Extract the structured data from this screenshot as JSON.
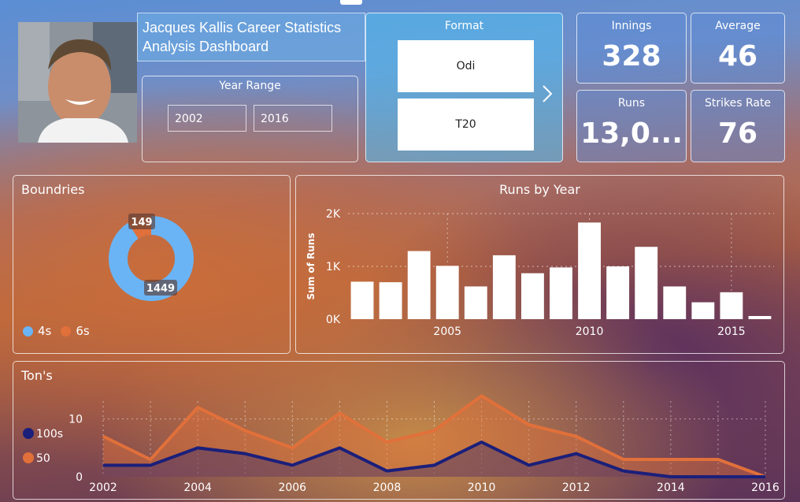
{
  "header": {
    "title": "Jacques Kallis Career Statistics Analysis Dashboard"
  },
  "year_range": {
    "title": "Year Range",
    "from": "2002",
    "to": "2016"
  },
  "format": {
    "title": "Format",
    "options": [
      "Odi",
      "T20"
    ],
    "next_icon": "chevron-right-icon"
  },
  "kpis": {
    "innings": {
      "label": "Innings",
      "value": "328"
    },
    "average": {
      "label": "Average",
      "value": "46"
    },
    "runs": {
      "label": "Runs",
      "value": "13,0..."
    },
    "strike_rate": {
      "label": "Strikes Rate",
      "value": "76"
    }
  },
  "colors": {
    "s4": "#6ab4f5",
    "s6": "#e1703a",
    "c100": "#1b1f7a",
    "c50": "#e1703a"
  },
  "boundaries": {
    "title": "Boundries",
    "legend": [
      "4s",
      "6s"
    ],
    "chart_data": {
      "type": "pie",
      "categories": [
        "4s",
        "6s"
      ],
      "values": [
        1449,
        149
      ],
      "labels": [
        "1449",
        "149"
      ]
    }
  },
  "runs_by_year": {
    "title": "Runs by Year",
    "ylabel": "Sum of Runs",
    "chart_data": {
      "type": "bar",
      "categories": [
        2002,
        2003,
        2004,
        2005,
        2006,
        2007,
        2008,
        2009,
        2010,
        2011,
        2012,
        2013,
        2014,
        2015,
        2016
      ],
      "values": [
        710,
        700,
        1290,
        1010,
        620,
        1210,
        870,
        980,
        1830,
        1000,
        1370,
        620,
        320,
        510,
        60
      ],
      "ylim": [
        0,
        2000
      ],
      "yticks": [
        "0K",
        "1K",
        "2K"
      ],
      "xticks": [
        "2005",
        "2010",
        "2015"
      ]
    }
  },
  "tons": {
    "title": "Ton's",
    "legend": [
      "100s",
      "50"
    ],
    "chart_data": {
      "type": "area",
      "x": [
        2002,
        2003,
        2004,
        2005,
        2006,
        2007,
        2008,
        2009,
        2010,
        2011,
        2012,
        2013,
        2014,
        2015,
        2016
      ],
      "series": [
        {
          "name": "100s",
          "values": [
            2,
            2,
            5,
            4,
            2,
            5,
            1,
            2,
            6,
            2,
            4,
            1,
            0,
            0,
            0
          ]
        },
        {
          "name": "50",
          "values": [
            7,
            3,
            12,
            8,
            5,
            11,
            6,
            8,
            14,
            9,
            7,
            3,
            3,
            3,
            0
          ]
        }
      ],
      "ylim": [
        0,
        15
      ],
      "yticks": [
        "0",
        "10"
      ],
      "xticks": [
        "2002",
        "2004",
        "2006",
        "2008",
        "2010",
        "2012",
        "2014",
        "2016"
      ]
    }
  }
}
